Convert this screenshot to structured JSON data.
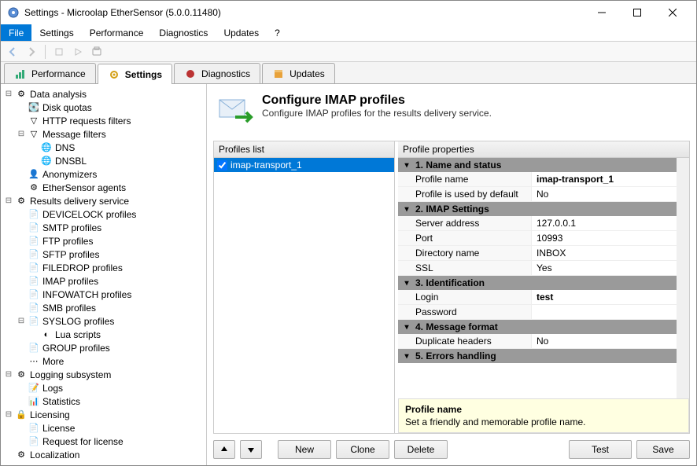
{
  "window": {
    "title": "Settings - Microolap EtherSensor (5.0.0.11480)"
  },
  "menu": {
    "file": "File",
    "settings": "Settings",
    "performance": "Performance",
    "diagnostics": "Diagnostics",
    "updates": "Updates",
    "help": "?"
  },
  "tabs": {
    "performance": "Performance",
    "settings": "Settings",
    "diagnostics": "Diagnostics",
    "updates": "Updates"
  },
  "tree": {
    "data_analysis": "Data analysis",
    "disk_quotas": "Disk quotas",
    "http_filters": "HTTP requests filters",
    "message_filters": "Message filters",
    "dns": "DNS",
    "dnsbl": "DNSBL",
    "anonymizers": "Anonymizers",
    "agents": "EtherSensor agents",
    "results": "Results delivery service",
    "devicelock": "DEVICELOCK profiles",
    "smtp": "SMTP profiles",
    "ftp": "FTP profiles",
    "sftp": "SFTP profiles",
    "filedrop": "FILEDROP profiles",
    "imap": "IMAP profiles",
    "infowatch": "INFOWATCH profiles",
    "smb": "SMB profiles",
    "syslog": "SYSLOG profiles",
    "lua": "Lua scripts",
    "group": "GROUP profiles",
    "more": "More",
    "logging": "Logging subsystem",
    "logs": "Logs",
    "statistics": "Statistics",
    "licensing": "Licensing",
    "license": "License",
    "request": "Request for license",
    "localization": "Localization"
  },
  "header": {
    "title": "Configure IMAP profiles",
    "subtitle": "Configure IMAP profiles for the results delivery service."
  },
  "panels": {
    "profiles_list": "Profiles list",
    "profile_properties": "Profile properties"
  },
  "list": {
    "item1": "imap-transport_1"
  },
  "groups": {
    "g1": "1. Name and status",
    "g2": "2. IMAP Settings",
    "g3": "3. Identification",
    "g4": "4. Message format",
    "g5": "5. Errors handling"
  },
  "props": {
    "profile_name_label": "Profile name",
    "profile_name_value": "imap-transport_1",
    "default_label": "Profile is used by default",
    "default_value": "No",
    "server_label": "Server address",
    "server_value": "127.0.0.1",
    "port_label": "Port",
    "port_value": "10993",
    "dir_label": "Directory name",
    "dir_value": "INBOX",
    "ssl_label": "SSL",
    "ssl_value": "Yes",
    "login_label": "Login",
    "login_value": "test",
    "password_label": "Password",
    "password_value": "",
    "dup_label": "Duplicate headers",
    "dup_value": "No"
  },
  "hint": {
    "title": "Profile name",
    "text": "Set a friendly and memorable profile name."
  },
  "buttons": {
    "new": "New",
    "clone": "Clone",
    "delete": "Delete",
    "test": "Test",
    "save": "Save"
  }
}
